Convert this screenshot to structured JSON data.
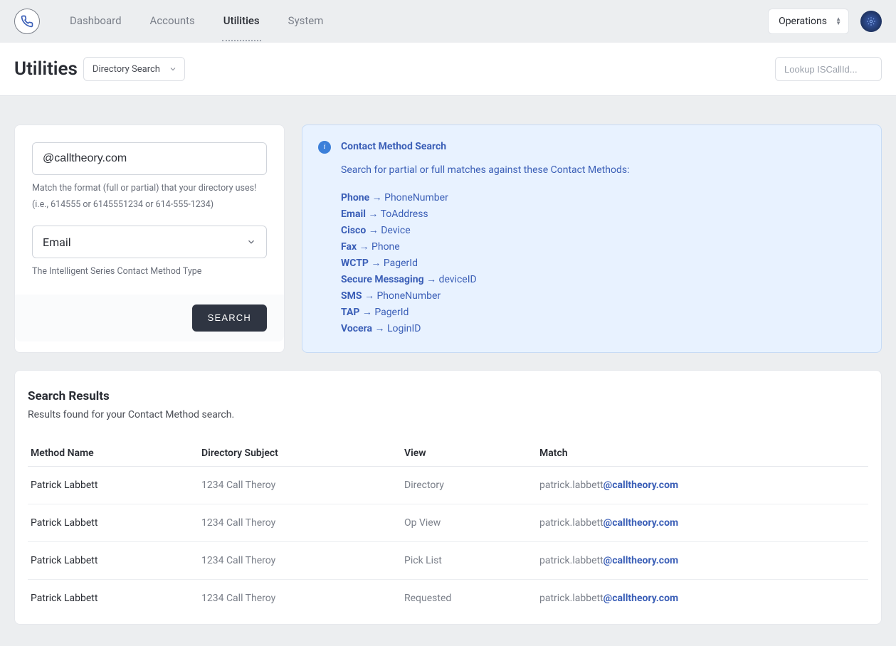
{
  "nav": {
    "items": [
      {
        "label": "Dashboard",
        "active": false
      },
      {
        "label": "Accounts",
        "active": false
      },
      {
        "label": "Utilities",
        "active": true
      },
      {
        "label": "System",
        "active": false
      }
    ]
  },
  "topbar": {
    "ops_label": "Operations"
  },
  "page": {
    "title": "Utilities",
    "dir_select_label": "Directory Search",
    "lookup_placeholder": "Lookup ISCallId..."
  },
  "search": {
    "input_value": "@calltheory.com",
    "help_line1": "Match the format (full or partial) that your directory uses!",
    "help_line2": "(i.e., 614555 or 6145551234 or 614-555-1234)",
    "type_value": "Email",
    "type_help": "The Intelligent Series Contact Method Type",
    "button_label": "SEARCH"
  },
  "info": {
    "title": "Contact Method Search",
    "subtitle": "Search for partial or full matches against these Contact Methods:",
    "methods": [
      {
        "type": "Phone",
        "field": "PhoneNumber"
      },
      {
        "type": "Email",
        "field": "ToAddress"
      },
      {
        "type": "Cisco",
        "field": "Device"
      },
      {
        "type": "Fax",
        "field": "Phone"
      },
      {
        "type": "WCTP",
        "field": "PagerId"
      },
      {
        "type": "Secure Messaging",
        "field": "deviceID"
      },
      {
        "type": "SMS",
        "field": "PhoneNumber"
      },
      {
        "type": "TAP",
        "field": "PagerId"
      },
      {
        "type": "Vocera",
        "field": "LoginID"
      }
    ]
  },
  "results": {
    "title": "Search Results",
    "subtitle": "Results found for your Contact Method search.",
    "columns": [
      "Method Name",
      "Directory Subject",
      "View",
      "Match"
    ],
    "rows": [
      {
        "name": "Patrick Labbett",
        "subject": "1234 Call Theroy",
        "view": "Directory",
        "match_plain": "patrick.labbett",
        "match_bold": "@calltheory.com"
      },
      {
        "name": "Patrick Labbett",
        "subject": "1234 Call Theroy",
        "view": "Op View",
        "match_plain": "patrick.labbett",
        "match_bold": "@calltheory.com"
      },
      {
        "name": "Patrick Labbett",
        "subject": "1234 Call Theroy",
        "view": "Pick List",
        "match_plain": "patrick.labbett",
        "match_bold": "@calltheory.com"
      },
      {
        "name": "Patrick Labbett",
        "subject": "1234 Call Theroy",
        "view": "Requested",
        "match_plain": "patrick.labbett",
        "match_bold": "@calltheory.com"
      }
    ]
  }
}
